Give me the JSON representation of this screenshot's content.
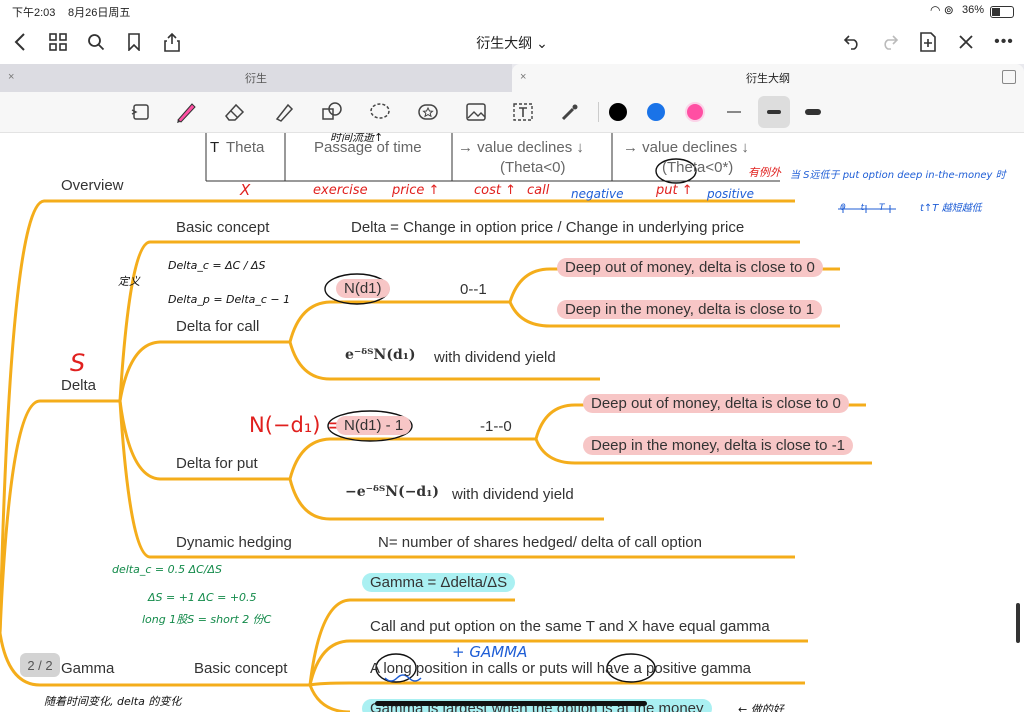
{
  "status": {
    "time": "下午2:03",
    "date": "8月26日周五",
    "battery": "36%"
  },
  "nav": {
    "title": "衍生大纲 ⌄"
  },
  "tabs": [
    {
      "label": "衍生"
    },
    {
      "label": "衍生大纲"
    }
  ],
  "colors": {
    "accent_blue": "#1a73e8",
    "branch_orange": "#f4ad1b",
    "highlight_pink": "#f7c6c6",
    "highlight_cyan": "#aaf0f2",
    "pen_pink": "#ff4fa3"
  },
  "table": {
    "theta_label": "Theta",
    "theta_prefix": "T",
    "passage": "Passage of time",
    "passage_hand": "时间流逝↑",
    "call_col": "value declines",
    "call_col2": "(Theta<0)",
    "put_col": "value declines",
    "put_col2": "(Theta<0*)"
  },
  "ann": {
    "x": "X",
    "exercise": "exercise",
    "price": "price ↑",
    "cost": "cost ↑",
    "call": "call",
    "negative": "negative",
    "put": "put ↑",
    "positive": "positive",
    "blue_note1": "有例外",
    "blue_note2": "当 S远低于 put option deep in-the-money 时",
    "blue_note3": "0  t  T",
    "blue_note4": "t↑T 越短越低",
    "def_label": "定义",
    "delta_c": "Delta_c = ΔC / ΔS",
    "delta_p": "Delta_p = Delta_c − 1",
    "s_mark": "S",
    "n_minus": "N(−d₁) =",
    "gamma_word": "+ GAMMA",
    "green1": "delta_c = 0.5   ΔC/ΔS",
    "green2": "ΔS = +1    ΔC = +0.5",
    "green3": "long 1股S = short 2 份C",
    "bottom_note": "随着时间变化, delta 的变化",
    "right_bottom": "← 做的好"
  },
  "outline": {
    "overview": "Overview",
    "delta": "Delta",
    "gamma": "Gamma",
    "basic_concept": "Basic concept",
    "basic_concept_text": "Delta = Change in option price / Change in underlying price",
    "delta_call": "Delta for call",
    "nd1": "N(d1)",
    "range_call": "0--1",
    "call_otm": "Deep out of money, delta is close to 0",
    "call_itm": "Deep in the money, delta is close to 1",
    "call_div_formula": "e⁻ᵟᵀN(d₁)",
    "with_div": "with dividend yield",
    "delta_put": "Delta for put",
    "nd1m1": "N(d1) - 1",
    "range_put": "-1--0",
    "put_otm": "Deep out of money, delta is close to 0",
    "put_itm": "Deep in the money, delta is close to -1",
    "put_div_formula": "−e⁻ᵟᵀN(−d₁)",
    "with_div2": "with dividend yield",
    "dynamic": "Dynamic hedging",
    "dynamic_text": "N= number of shares hedged/ delta of call option",
    "gamma_def": "Gamma = Δdelta/ΔS",
    "gamma_basic": "Basic concept",
    "gamma_1": "Call and put option on the same T and X have equal gamma",
    "gamma_2": "A long position in calls or puts will have a positive gamma",
    "gamma_3": "Gamma is largest when the option is at the money"
  },
  "page_indicator": "2 / 2"
}
